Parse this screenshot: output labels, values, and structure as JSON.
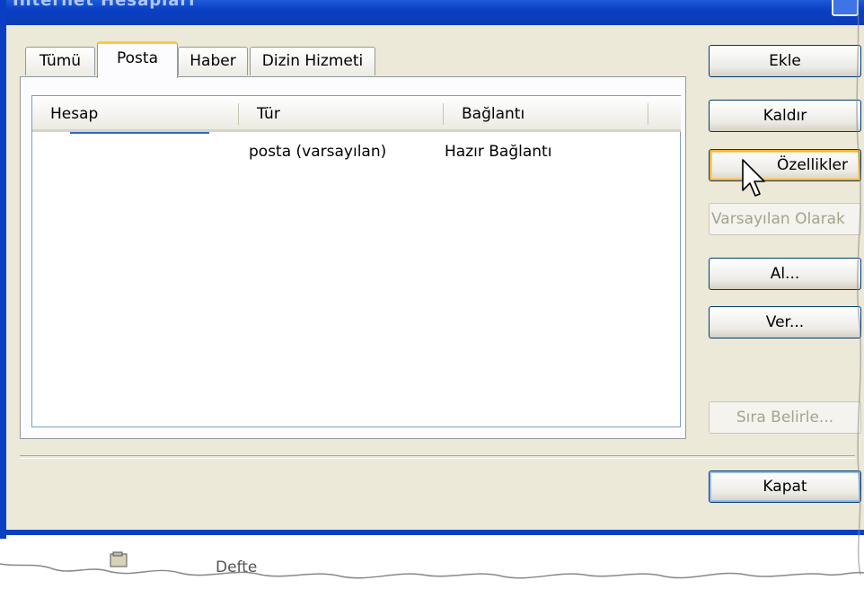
{
  "window": {
    "title": "İnternet Hesapları"
  },
  "tabs": [
    {
      "label": "Tümü"
    },
    {
      "label": "Posta"
    },
    {
      "label": "Haber"
    },
    {
      "label": "Dizin Hizmeti"
    }
  ],
  "list": {
    "columns": [
      "Hesap",
      "Tür",
      "Bağlantı"
    ],
    "rows": [
      {
        "hesap": "",
        "tur": "posta (varsayılan)",
        "baglanti": "Hazır Bağlantı"
      }
    ]
  },
  "buttons": {
    "ekle": "Ekle",
    "kaldir": "Kaldır",
    "ozellikler": "Özellikler",
    "varsayilan": "Varsayılan Olarak",
    "al": "Al...",
    "ver": "Ver...",
    "sira": "Sıra Belirle...",
    "kapat": "Kapat"
  },
  "background": {
    "partial_text": "Defte"
  },
  "colors": {
    "titlebar": "#0a3fc4",
    "dialog": "#ece9d8",
    "hover": "#f8b33a",
    "selection": "#316ac5"
  }
}
